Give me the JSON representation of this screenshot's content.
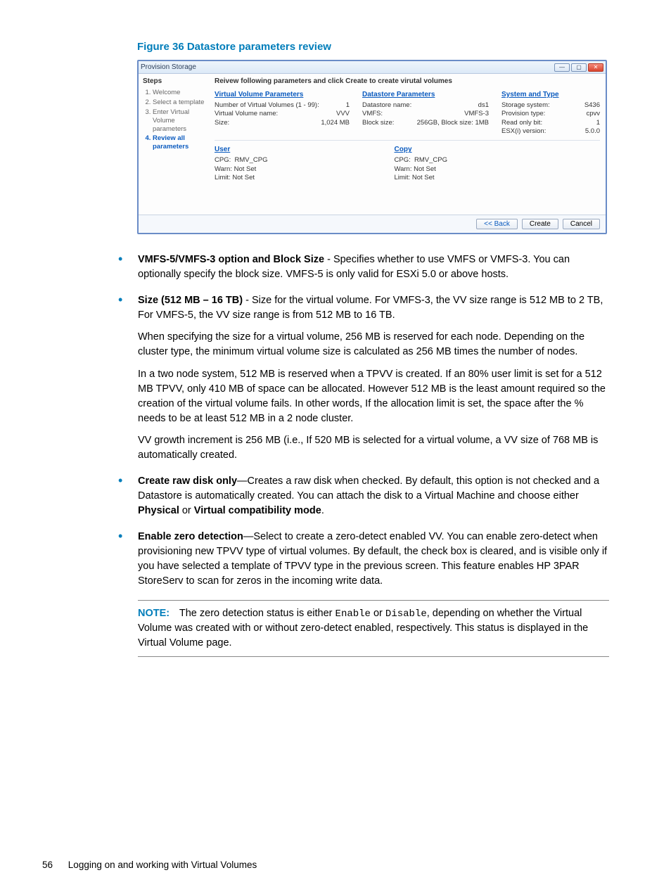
{
  "figure_caption": "Figure 36 Datastore parameters review",
  "window": {
    "title": "Provision Storage",
    "steps_header": "Steps",
    "steps": [
      {
        "label": "Welcome",
        "active": false
      },
      {
        "label": "Select a template",
        "active": false
      },
      {
        "label": "Enter Virtual Volume parameters",
        "active": false
      },
      {
        "label": "Review all parameters",
        "active": true
      }
    ],
    "instruction": "Reivew following parameters and click Create to create virutal volumes",
    "vv_params": {
      "title": "Virtual Volume Parameters",
      "num_vv_label": "Number of Virtual Volumes (1 - 99):",
      "num_vv_value": "1",
      "name_label": "Virtual Volume name:",
      "name_value": "VVV",
      "size_label": "Size:",
      "size_value": "1,024 MB"
    },
    "ds_params": {
      "title": "Datastore Parameters",
      "ds_name_label": "Datastore name:",
      "ds_name_value": "ds1",
      "vmfs_label": "VMFS:",
      "vmfs_value": "VMFS-3",
      "block_label": "Block size:",
      "block_value": "256GB, Block size: 1MB"
    },
    "sys_type": {
      "title": "System and Type",
      "storage_label": "Storage system:",
      "storage_value": "S436",
      "prov_label": "Provision type:",
      "prov_value": "cpvv",
      "readonly_label": "Read only bit:",
      "readonly_value": "1",
      "esx_label": "ESX(i) version:",
      "esx_value": "5.0.0"
    },
    "user": {
      "title": "User",
      "cpg_label": "CPG:",
      "cpg_value": "RMV_CPG",
      "warn_label": "Warn:",
      "warn_value": "Not Set",
      "limit_label": "Limit:",
      "limit_value": "Not Set"
    },
    "copy": {
      "title": "Copy",
      "cpg_label": "CPG:",
      "cpg_value": "RMV_CPG",
      "warn_label": "Warn:",
      "warn_value": "Not Set",
      "limit_label": "Limit:",
      "limit_value": "Not Set"
    },
    "buttons": {
      "back": "<< Back",
      "create": "Create",
      "cancel": "Cancel"
    }
  },
  "bullets": {
    "b1_title": "VMFS-5/VMFS-3 option and Block Size",
    "b1_text": " - Specifies whether to use VMFS or VMFS-3. You can optionally specify the block size. VMFS-5 is only valid for ESXi 5.0 or above hosts.",
    "b2_title": "Size (512 MB – 16 TB)",
    "b2_text": " - Size for the virtual volume. For VMFS-3, the VV size range is 512 MB to 2 TB, For VMFS-5, the VV size range is from 512 MB to 16 TB.",
    "b2_p1": "When specifying the size for a virtual volume, 256 MB is reserved for each node. Depending on the cluster type, the minimum virtual volume size is calculated as 256 MB times the number of nodes.",
    "b2_p2": "In a two node system, 512 MB is reserved when a TPVV is created. If an 80% user limit is set for a 512 MB TPVV, only 410 MB of space can be allocated. However 512 MB is the least amount required so the creation of the virtual volume fails. In other words, If the allocation limit is set, the space after the % needs to be at least 512 MB in a 2 node cluster.",
    "b2_p3": "VV growth increment is 256 MB (i.e., If 520 MB is selected for a virtual volume, a VV size of 768 MB is automatically created.",
    "b3_title": "Create raw disk only",
    "b3_text": "—Creates a raw disk when checked. By default, this option is not checked and a Datastore is automatically created. You can attach the disk to a Virtual Machine and choose either ",
    "b3_bold1": "Physical",
    "b3_mid": " or ",
    "b3_bold2": "Virtual compatibility mode",
    "b3_end": ".",
    "b4_title": "Enable zero detection",
    "b4_text": "—Select to create a zero-detect enabled VV. You can enable zero-detect when provisioning new TPVV type of virtual volumes. By default, the check box is cleared, and is visible only if you have selected a template of TPVV type in the previous screen. This feature enables HP 3PAR StoreServ to scan for zeros in the incoming write data."
  },
  "note": {
    "label": "NOTE:",
    "t1": "The zero detection status is either ",
    "code1": "Enable",
    "t2": " or ",
    "code2": "Disable",
    "t3": ", depending on whether the Virtual Volume was created with or without zero-detect enabled, respectively. This status is displayed in the Virtual Volume page."
  },
  "footer": {
    "page": "56",
    "text": "Logging on and working with Virtual Volumes"
  }
}
